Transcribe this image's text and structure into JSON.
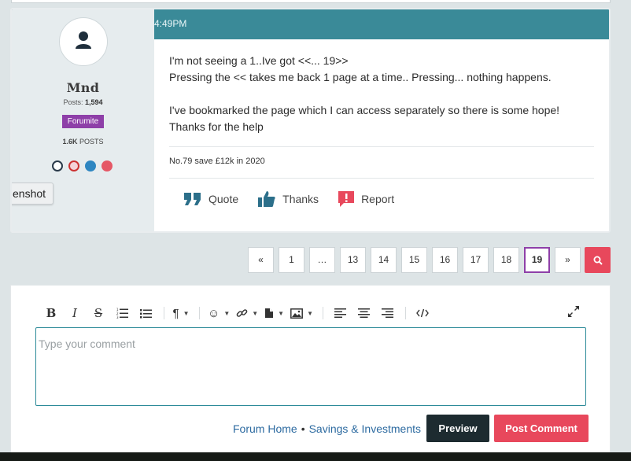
{
  "post": {
    "time": "4:49PM",
    "author": {
      "name": "Mnd",
      "posts_label": "Posts:",
      "posts_value": "1,594",
      "rank": "Forumite",
      "posts_count_value": "1.6K",
      "posts_count_label": "POSTS"
    },
    "body": [
      "I'm not seeing a 1..Ive got <<... 19>>",
      "Pressing the << takes me back 1 page at a time.. Pressing... nothing happens.",
      "I've bookmarked the page which I can access separately so there is some hope!",
      "Thanks for the help"
    ],
    "signature": "No.79 save £12k in 2020",
    "actions": {
      "quote": "Quote",
      "thanks": "Thanks",
      "report": "Report"
    }
  },
  "tooltip": "enshot",
  "pagination": {
    "pages": [
      "«",
      "1",
      "…",
      "13",
      "14",
      "15",
      "16",
      "17",
      "18",
      "19",
      "»"
    ],
    "active": "19"
  },
  "editor": {
    "placeholder": "Type your comment"
  },
  "footer": {
    "crumb_home": "Forum Home",
    "crumb_sep": "•",
    "crumb_category": "Savings & Investments",
    "preview": "Preview",
    "post_comment": "Post Comment"
  },
  "colors": {
    "header": "#3a8a98",
    "rank_badge": "#8e3fa8",
    "accent_red": "#e8485c",
    "dark_button": "#1d2b30"
  }
}
